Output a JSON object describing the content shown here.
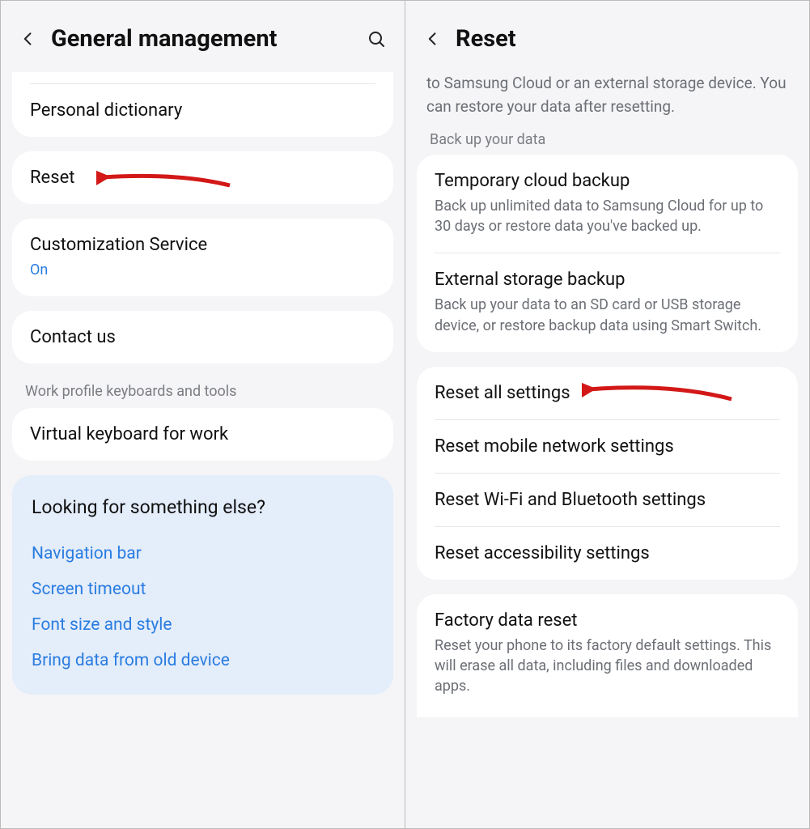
{
  "left": {
    "title": "General management",
    "personal_dictionary": "Personal dictionary",
    "reset": "Reset",
    "customization_service": {
      "title": "Customization Service",
      "status": "On"
    },
    "contact_us": "Contact us",
    "section_work": "Work profile keyboards and tools",
    "virtual_keyboard": "Virtual keyboard for work",
    "looking": {
      "heading": "Looking for something else?",
      "links": [
        "Navigation bar",
        "Screen timeout",
        "Font size and style",
        "Bring data from old device"
      ]
    }
  },
  "right": {
    "title": "Reset",
    "intro": "to Samsung Cloud or an external storage device. You can restore your data after resetting.",
    "section_backup": "Back up your data",
    "temp_backup": {
      "title": "Temporary cloud backup",
      "sub": "Back up unlimited data to Samsung Cloud for up to 30 days or restore data you've backed up."
    },
    "ext_backup": {
      "title": "External storage backup",
      "sub": "Back up your data to an SD card or USB storage device, or restore backup data using Smart Switch."
    },
    "reset_all": "Reset all settings",
    "reset_mobile": "Reset mobile network settings",
    "reset_wifi": "Reset Wi-Fi and Bluetooth settings",
    "reset_access": "Reset accessibility settings",
    "factory": {
      "title": "Factory data reset",
      "sub": "Reset your phone to its factory default settings. This will erase all data, including files and downloaded apps."
    }
  }
}
